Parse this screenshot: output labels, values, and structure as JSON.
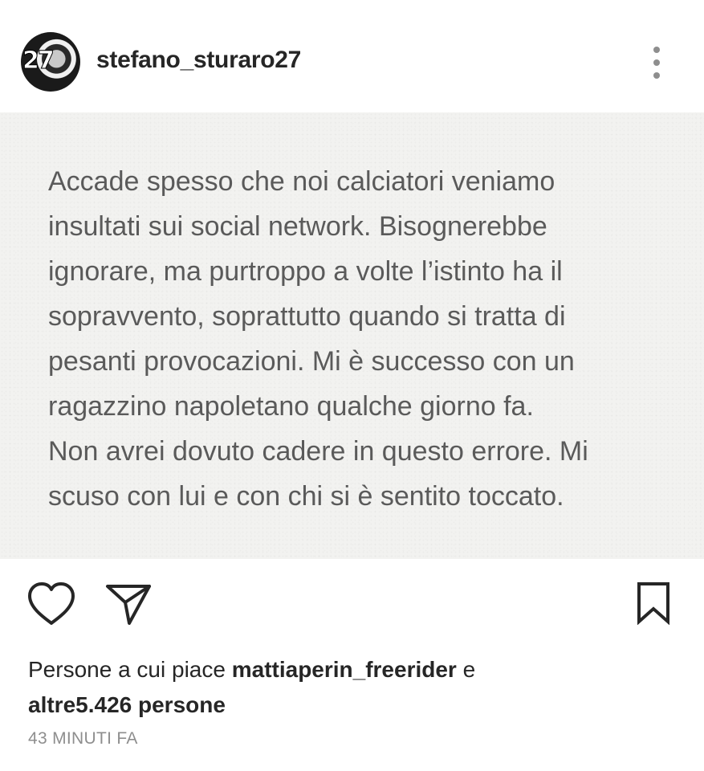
{
  "header": {
    "username": "stefano_sturaro27",
    "avatar_badge": "27"
  },
  "post": {
    "text": "Accade spesso che noi calciatori veniamo\ninsultati sui social network. Bisognerebbe\nignorare, ma purtroppo a volte l’istinto ha il\nsopravvento, soprattutto quando si tratta di\npesanti provocazioni. Mi è successo con un\nragazzino napoletano qualche giorno fa.\nNon avrei dovuto cadere in questo errore. Mi\nscuso con lui e con chi si è sentito toccato."
  },
  "actions": {
    "icons": [
      "heart-icon",
      "send-icon",
      "bookmark-icon"
    ]
  },
  "likes": {
    "prefix": "Persone a cui piace ",
    "first_user": "mattiaperin_freerider",
    "middle": " e",
    "others": "altre5.426 persone"
  },
  "timestamp": "43 MINUTI FA"
}
